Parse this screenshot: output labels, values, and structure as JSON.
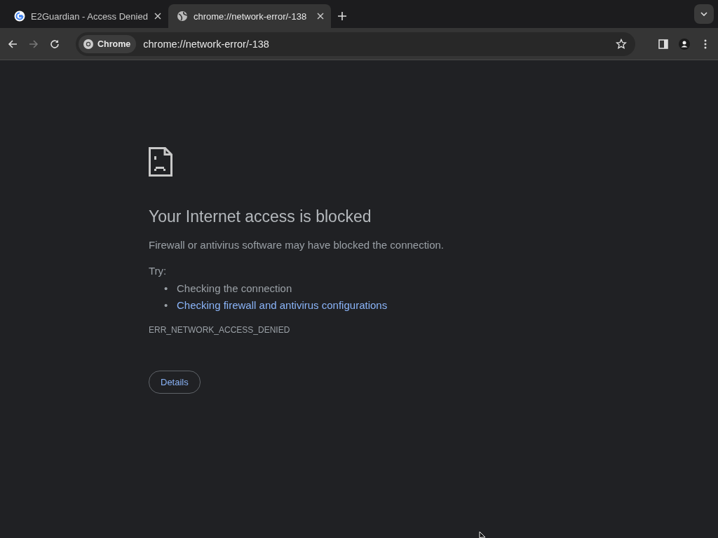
{
  "tabs": [
    {
      "title": "E2Guardian - Access Denied",
      "kind": "google",
      "selected": false
    },
    {
      "title": "chrome://network-error/-138",
      "kind": "globe",
      "selected": true
    }
  ],
  "toolbar": {
    "chip": "Chrome",
    "url": "chrome://network-error/-138",
    "forward_disabled": true
  },
  "error": {
    "heading": "Your Internet access is blocked",
    "message": "Firewall or antivirus software may have blocked the connection.",
    "try_label": "Try:",
    "suggestions": [
      {
        "kind": "text",
        "bullet": "•",
        "text": "Checking the connection"
      },
      {
        "kind": "link",
        "bullet": "•",
        "text": "Checking firewall and antivirus configurations"
      }
    ],
    "code": "ERR_NETWORK_ACCESS_DENIED",
    "details_button": "Details"
  }
}
